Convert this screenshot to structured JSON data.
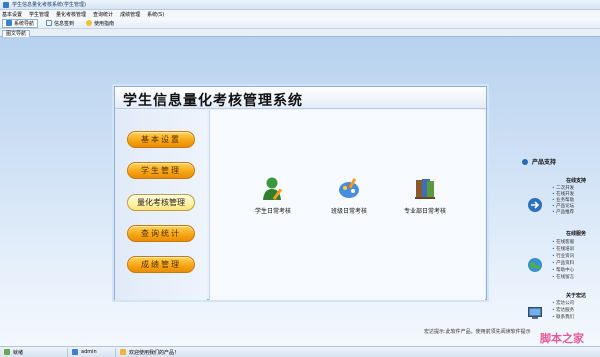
{
  "window": {
    "title": "学生信息量化考核系统(学生管理)"
  },
  "menu": [
    "基本设置",
    "学生管理",
    "量化考核管理",
    "查询统计",
    "成绩管理",
    "系统(S)"
  ],
  "toolbar": {
    "items": [
      "系统导航",
      "信息签到",
      "使用指南"
    ]
  },
  "tabs": [
    "图文导航"
  ],
  "panel": {
    "title": "学生信息量化考核管理系统",
    "nav": [
      "基本设置",
      "学生管理",
      "量化考核管理",
      "查询统计",
      "成绩管理"
    ],
    "selected_nav": "量化考核管理",
    "modules": [
      "学生日常考核",
      "班级日常考核",
      "专业部日常考核"
    ]
  },
  "right_panel": {
    "title": "产品支持",
    "sections": [
      {
        "heading": "在线支持",
        "items": [
          "二次开发",
          "在线开发",
          "业务帮助",
          "产品论坛",
          "产品推荐"
        ]
      },
      {
        "heading": "在线服务",
        "items": [
          "在线客服",
          "在线培训",
          "行业资讯",
          "产品资料",
          "帮助中心",
          "在线留言"
        ]
      },
      {
        "heading": "关于宏达",
        "items": [
          "宏达公司",
          "宏达服务",
          "联系我们"
        ]
      }
    ]
  },
  "footer_note": "宏达提示:此软件产品，使用前须先阅读软件提示",
  "watermark": "脚本之家",
  "status": {
    "items": [
      "就绪",
      "admin",
      "欢迎使用我们的产品！"
    ]
  },
  "colors": {
    "nav_button": "#f6a716",
    "accent": "#2a6ab5",
    "workarea_top": "#b7d2ef"
  }
}
